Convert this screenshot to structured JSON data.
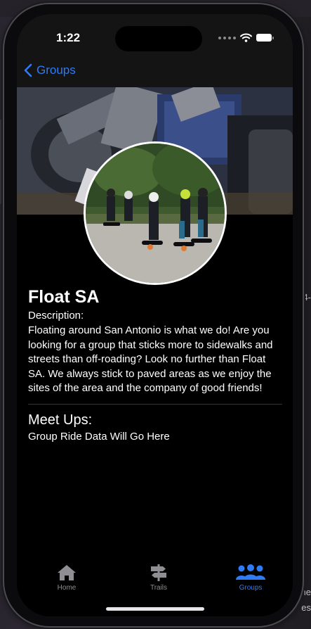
{
  "status_bar": {
    "time": "1:22"
  },
  "nav": {
    "back_label": "Groups"
  },
  "group": {
    "name": "Float SA",
    "description_label": "Description:",
    "description": "Floating around San Antonio is what we do! Are you looking for a group that sticks more to sidewalks and streets than off-roading? Look no further than Float SA. We always stick to paved areas as we enjoy the sites of the area and the company of good friends!",
    "meetups_title": "Meet Ups:",
    "meetups_text": "Group Ride Data Will Go Here"
  },
  "tabs": [
    {
      "label": "Home",
      "icon": "house-icon",
      "active": false
    },
    {
      "label": "Trails",
      "icon": "signpost-icon",
      "active": false
    },
    {
      "label": "Groups",
      "icon": "people-icon",
      "active": true
    }
  ],
  "background": {
    "fragment_1": "4-",
    "fragment_2": "he",
    "fragment_3": "es"
  },
  "colors": {
    "accent": "#2f7bf6",
    "inactive_tab": "#8e8e93",
    "screen_bg": "#000000",
    "nav_bg": "#141414"
  }
}
